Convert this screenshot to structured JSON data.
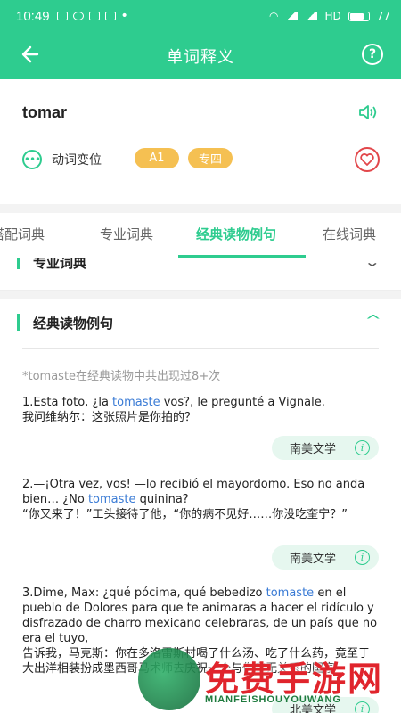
{
  "status_bar": {
    "time": "10:49",
    "network": "HD",
    "battery": "77"
  },
  "app_bar": {
    "title": "单词释义",
    "help_glyph": "?"
  },
  "word": {
    "text": "tomar",
    "conjugation_label": "动词变位",
    "badges": [
      "A1",
      "专四"
    ]
  },
  "tabs": [
    {
      "label": "搭配词典",
      "active": false
    },
    {
      "label": "专业词典",
      "active": false
    },
    {
      "label": "经典读物例句",
      "active": true
    },
    {
      "label": "在线词典",
      "active": false
    }
  ],
  "collapsed_section": {
    "label": "专业词典"
  },
  "section": {
    "title": "经典读物例句",
    "count_text": "*tomaste在经典读物中共出现过8+次",
    "examples": [
      {
        "before": "1.Esta foto, ¿la ",
        "highlight": "tomaste",
        "after": " vos?, le pregunté a Vignale.",
        "translation": "我问维纳尔：这张照片是你拍的？",
        "source": "南美文学"
      },
      {
        "before": "2.—¡Otra vez, vos! —lo recibió el mayordomo. Eso no anda bien… ¿No ",
        "highlight": "tomaste",
        "after": " quinina?",
        "translation": "“你又来了！”工头接待了他，“你的病不见好……你没吃奎宁？”",
        "source": "南美文学"
      },
      {
        "before": "3.Dime, Max: ¿qué pócima, qué bebedizo ",
        "highlight": "tomaste",
        "after": " en el pueblo de Dolores para que te animaras a hacer el ridículo y disfrazado de charro mexicano celebraras, de un país que no era el tuyo,",
        "translation": "告诉我，马克斯：你在多洛雷斯村喝了什么汤、吃了什么药，竟至于大出洋相装扮成墨西哥马术师去庆祝一个与你毫无关系的国家",
        "source": "北美文学"
      }
    ]
  },
  "watermark": {
    "main": "免费手游网",
    "sub": "MIANFEISHOUYOUWANG"
  },
  "colors": {
    "brand": "#2ecc8f",
    "badge": "#f5c052",
    "highlight": "#3a7bd5",
    "heart": "#e2474b"
  }
}
